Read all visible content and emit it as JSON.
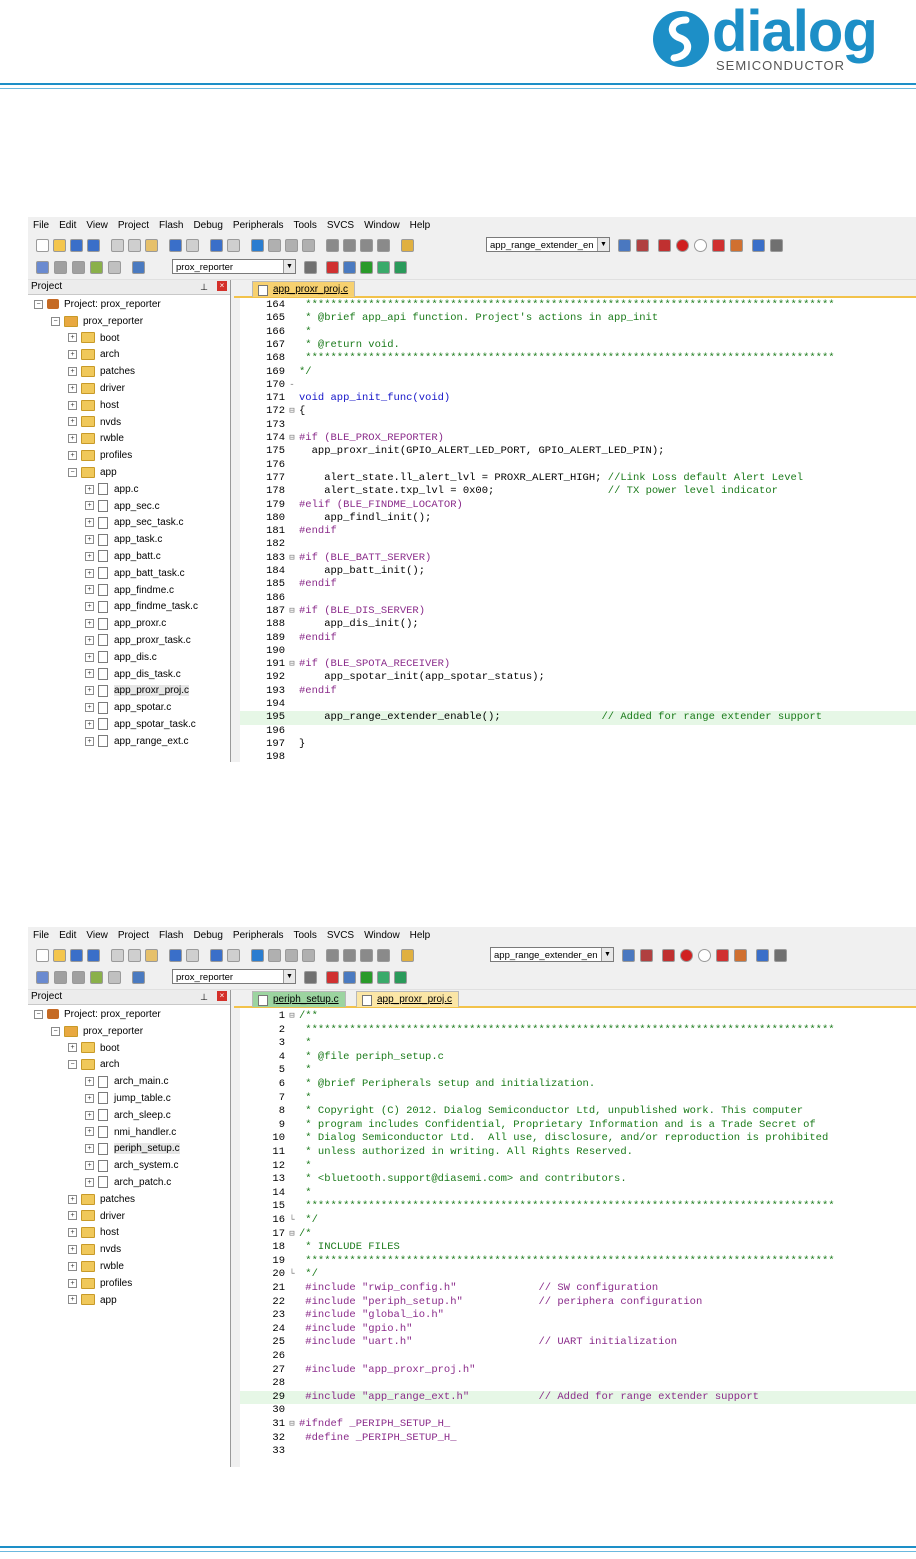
{
  "document": {
    "logo_text": "dialog",
    "logo_subtext": "SEMICONDUCTOR",
    "brand_color": "#1d8fc7"
  },
  "screenshots": [
    {
      "menu": [
        "File",
        "Edit",
        "View",
        "Project",
        "Flash",
        "Debug",
        "Peripherals",
        "Tools",
        "SVCS",
        "Window",
        "Help"
      ],
      "target_combo": "app_range_extender_en",
      "project_combo": "prox_reporter",
      "panel_title": "Project",
      "tree": [
        {
          "label": "Project: prox_reporter",
          "kind": "project",
          "level": 0
        },
        {
          "label": "prox_reporter",
          "kind": "group",
          "level": 1
        },
        {
          "label": "boot",
          "kind": "folder",
          "level": 2
        },
        {
          "label": "arch",
          "kind": "folder",
          "level": 2
        },
        {
          "label": "patches",
          "kind": "folder",
          "level": 2
        },
        {
          "label": "driver",
          "kind": "folder",
          "level": 2
        },
        {
          "label": "host",
          "kind": "folder",
          "level": 2
        },
        {
          "label": "nvds",
          "kind": "folder",
          "level": 2
        },
        {
          "label": "rwble",
          "kind": "folder",
          "level": 2
        },
        {
          "label": "profiles",
          "kind": "folder",
          "level": 2
        },
        {
          "label": "app",
          "kind": "folder-open",
          "level": 2
        },
        {
          "label": "app.c",
          "kind": "file",
          "level": 3
        },
        {
          "label": "app_sec.c",
          "kind": "file",
          "level": 3
        },
        {
          "label": "app_sec_task.c",
          "kind": "file",
          "level": 3
        },
        {
          "label": "app_task.c",
          "kind": "file",
          "level": 3
        },
        {
          "label": "app_batt.c",
          "kind": "file",
          "level": 3
        },
        {
          "label": "app_batt_task.c",
          "kind": "file",
          "level": 3
        },
        {
          "label": "app_findme.c",
          "kind": "file",
          "level": 3
        },
        {
          "label": "app_findme_task.c",
          "kind": "file",
          "level": 3
        },
        {
          "label": "app_proxr.c",
          "kind": "file",
          "level": 3
        },
        {
          "label": "app_proxr_task.c",
          "kind": "file",
          "level": 3
        },
        {
          "label": "app_dis.c",
          "kind": "file",
          "level": 3
        },
        {
          "label": "app_dis_task.c",
          "kind": "file",
          "level": 3
        },
        {
          "label": "app_proxr_proj.c",
          "kind": "file",
          "level": 3,
          "selected": true
        },
        {
          "label": "app_spotar.c",
          "kind": "file",
          "level": 3
        },
        {
          "label": "app_spotar_task.c",
          "kind": "file",
          "level": 3
        },
        {
          "label": "app_range_ext.c",
          "kind": "file",
          "level": 3
        }
      ],
      "tabs": [
        {
          "label": "app_proxr_proj.c",
          "style": "active"
        }
      ],
      "code": [
        {
          "n": "164",
          "f": "",
          "t": " ************************************************************************************",
          "c": "com"
        },
        {
          "n": "165",
          "f": "",
          "t": " * @brief app_api function. Project's actions in app_init",
          "c": "com"
        },
        {
          "n": "166",
          "f": "",
          "t": " *",
          "c": "com"
        },
        {
          "n": "167",
          "f": "",
          "t": " * @return void.",
          "c": "com"
        },
        {
          "n": "168",
          "f": "",
          "t": " ************************************************************************************",
          "c": "com"
        },
        {
          "n": "169",
          "f": "",
          "t": "*/",
          "c": "com"
        },
        {
          "n": "170",
          "f": "-",
          "t": "",
          "c": ""
        },
        {
          "n": "171",
          "f": "",
          "t": "void app_init_func(void)",
          "c": "kwline"
        },
        {
          "n": "172",
          "f": "⊟",
          "t": "{",
          "c": ""
        },
        {
          "n": "173",
          "f": "",
          "t": "",
          "c": ""
        },
        {
          "n": "174",
          "f": "⊟",
          "t": "#if (BLE_PROX_REPORTER)",
          "c": "pp"
        },
        {
          "n": "175",
          "f": "",
          "t": "  app_proxr_init(GPIO_ALERT_LED_PORT, GPIO_ALERT_LED_PIN);",
          "c": ""
        },
        {
          "n": "176",
          "f": "",
          "t": "",
          "c": ""
        },
        {
          "n": "177",
          "f": "",
          "t": "    alert_state.ll_alert_lvl = PROXR_ALERT_HIGH; //Link Loss default Alert Level",
          "c": "mixed1"
        },
        {
          "n": "178",
          "f": "",
          "t": "    alert_state.txp_lvl = 0x00;                  // TX power level indicator",
          "c": "mixed2"
        },
        {
          "n": "179",
          "f": "",
          "t": "#elif (BLE_FINDME_LOCATOR)",
          "c": "pp"
        },
        {
          "n": "180",
          "f": "",
          "t": "    app_findl_init();",
          "c": ""
        },
        {
          "n": "181",
          "f": "",
          "t": "#endif",
          "c": "pp"
        },
        {
          "n": "182",
          "f": "",
          "t": "",
          "c": ""
        },
        {
          "n": "183",
          "f": "⊟",
          "t": "#if (BLE_BATT_SERVER)",
          "c": "pp"
        },
        {
          "n": "184",
          "f": "",
          "t": "    app_batt_init();",
          "c": ""
        },
        {
          "n": "185",
          "f": "",
          "t": "#endif",
          "c": "pp"
        },
        {
          "n": "186",
          "f": "",
          "t": "",
          "c": ""
        },
        {
          "n": "187",
          "f": "⊟",
          "t": "#if (BLE_DIS_SERVER)",
          "c": "pp"
        },
        {
          "n": "188",
          "f": "",
          "t": "    app_dis_init();",
          "c": ""
        },
        {
          "n": "189",
          "f": "",
          "t": "#endif",
          "c": "pp"
        },
        {
          "n": "190",
          "f": "",
          "t": "",
          "c": ""
        },
        {
          "n": "191",
          "f": "⊟",
          "t": "#if (BLE_SPOTA_RECEIVER)",
          "c": "pp"
        },
        {
          "n": "192",
          "f": "",
          "t": "    app_spotar_init(app_spotar_status);",
          "c": ""
        },
        {
          "n": "193",
          "f": "",
          "t": "#endif",
          "c": "pp"
        },
        {
          "n": "194",
          "f": "",
          "t": "",
          "c": ""
        },
        {
          "n": "195",
          "f": "",
          "t": "    app_range_extender_enable();                // Added for range extender support",
          "c": "mixed3",
          "hl": true
        },
        {
          "n": "196",
          "f": "",
          "t": "",
          "c": ""
        },
        {
          "n": "197",
          "f": "",
          "t": "}",
          "c": ""
        },
        {
          "n": "198",
          "f": "",
          "t": "",
          "c": ""
        }
      ]
    },
    {
      "menu": [
        "File",
        "Edit",
        "View",
        "Project",
        "Flash",
        "Debug",
        "Peripherals",
        "Tools",
        "SVCS",
        "Window",
        "Help"
      ],
      "target_combo": "app_range_extender_en",
      "project_combo": "prox_reporter",
      "panel_title": "Project",
      "tree": [
        {
          "label": "Project: prox_reporter",
          "kind": "project",
          "level": 0
        },
        {
          "label": "prox_reporter",
          "kind": "group",
          "level": 1
        },
        {
          "label": "boot",
          "kind": "folder",
          "level": 2
        },
        {
          "label": "arch",
          "kind": "folder-open",
          "level": 2
        },
        {
          "label": "arch_main.c",
          "kind": "file",
          "level": 3
        },
        {
          "label": "jump_table.c",
          "kind": "file",
          "level": 3
        },
        {
          "label": "arch_sleep.c",
          "kind": "file",
          "level": 3
        },
        {
          "label": "nmi_handler.c",
          "kind": "file",
          "level": 3
        },
        {
          "label": "periph_setup.c",
          "kind": "file",
          "level": 3,
          "selected": true
        },
        {
          "label": "arch_system.c",
          "kind": "file",
          "level": 3
        },
        {
          "label": "arch_patch.c",
          "kind": "file",
          "level": 3
        },
        {
          "label": "patches",
          "kind": "folder",
          "level": 2
        },
        {
          "label": "driver",
          "kind": "folder",
          "level": 2
        },
        {
          "label": "host",
          "kind": "folder",
          "level": 2
        },
        {
          "label": "nvds",
          "kind": "folder",
          "level": 2
        },
        {
          "label": "rwble",
          "kind": "folder",
          "level": 2
        },
        {
          "label": "profiles",
          "kind": "folder",
          "level": 2
        },
        {
          "label": "app",
          "kind": "folder",
          "level": 2
        }
      ],
      "tabs": [
        {
          "label": "periph_setup.c",
          "style": "green"
        },
        {
          "label": "app_proxr_proj.c",
          "style": "other"
        }
      ],
      "code": [
        {
          "n": "1",
          "f": "⊟",
          "t": "/**",
          "c": "com"
        },
        {
          "n": "2",
          "f": "",
          "t": " ************************************************************************************",
          "c": "com"
        },
        {
          "n": "3",
          "f": "",
          "t": " *",
          "c": "com"
        },
        {
          "n": "4",
          "f": "",
          "t": " * @file periph_setup.c",
          "c": "com"
        },
        {
          "n": "5",
          "f": "",
          "t": " *",
          "c": "com"
        },
        {
          "n": "6",
          "f": "",
          "t": " * @brief Peripherals setup and initialization.",
          "c": "com"
        },
        {
          "n": "7",
          "f": "",
          "t": " *",
          "c": "com"
        },
        {
          "n": "8",
          "f": "",
          "t": " * Copyright (C) 2012. Dialog Semiconductor Ltd, unpublished work. This computer",
          "c": "com"
        },
        {
          "n": "9",
          "f": "",
          "t": " * program includes Confidential, Proprietary Information and is a Trade Secret of",
          "c": "com"
        },
        {
          "n": "10",
          "f": "",
          "t": " * Dialog Semiconductor Ltd.  All use, disclosure, and/or reproduction is prohibited",
          "c": "com"
        },
        {
          "n": "11",
          "f": "",
          "t": " * unless authorized in writing. All Rights Reserved.",
          "c": "com"
        },
        {
          "n": "12",
          "f": "",
          "t": " *",
          "c": "com"
        },
        {
          "n": "13",
          "f": "",
          "t": " * <bluetooth.support@diasemi.com> and contributors.",
          "c": "com"
        },
        {
          "n": "14",
          "f": "",
          "t": " *",
          "c": "com"
        },
        {
          "n": "15",
          "f": "",
          "t": " ************************************************************************************",
          "c": "com"
        },
        {
          "n": "16",
          "f": "└",
          "t": " */",
          "c": "com"
        },
        {
          "n": "17",
          "f": "⊟",
          "t": "/*",
          "c": "com"
        },
        {
          "n": "18",
          "f": "",
          "t": " * INCLUDE FILES",
          "c": "com"
        },
        {
          "n": "19",
          "f": "",
          "t": " ************************************************************************************",
          "c": "com"
        },
        {
          "n": "20",
          "f": "└",
          "t": " */",
          "c": "com"
        },
        {
          "n": "21",
          "f": "",
          "t": " #include \"rwip_config.h\"             // SW configuration",
          "c": "inc"
        },
        {
          "n": "22",
          "f": "",
          "t": " #include \"periph_setup.h\"            // periphera configuration",
          "c": "inc"
        },
        {
          "n": "23",
          "f": "",
          "t": " #include \"global_io.h\"",
          "c": "inc"
        },
        {
          "n": "24",
          "f": "",
          "t": " #include \"gpio.h\"",
          "c": "inc"
        },
        {
          "n": "25",
          "f": "",
          "t": " #include \"uart.h\"                    // UART initialization",
          "c": "inc"
        },
        {
          "n": "26",
          "f": "",
          "t": "",
          "c": ""
        },
        {
          "n": "27",
          "f": "",
          "t": " #include \"app_proxr_proj.h\"",
          "c": "inc"
        },
        {
          "n": "28",
          "f": "",
          "t": "",
          "c": ""
        },
        {
          "n": "29",
          "f": "",
          "t": " #include \"app_range_ext.h\"           // Added for range extender support",
          "c": "inc",
          "hl": true
        },
        {
          "n": "30",
          "f": "",
          "t": "",
          "c": ""
        },
        {
          "n": "31",
          "f": "⊟",
          "t": "#ifndef _PERIPH_SETUP_H_",
          "c": "pp"
        },
        {
          "n": "32",
          "f": "",
          "t": " #define _PERIPH_SETUP_H_",
          "c": "pp"
        },
        {
          "n": "33",
          "f": "",
          "t": "",
          "c": ""
        }
      ]
    }
  ]
}
